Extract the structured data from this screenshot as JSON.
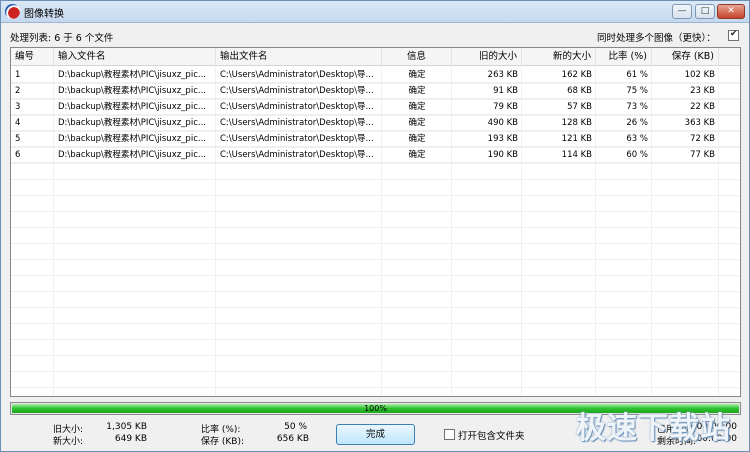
{
  "window": {
    "title": "图像转换",
    "buttons": {
      "minimize": "—",
      "maximize": "□",
      "close": "✕"
    }
  },
  "top": {
    "processing": "处理列表: 6 于 6 个文件",
    "multi_label": "同时处理多个图像（更快）：",
    "multi_checked": true
  },
  "table": {
    "columns": [
      "编号",
      "输入文件名",
      "输出文件名",
      "信息",
      "旧的大小",
      "新的大小",
      "比率 (%)",
      "保存 (KB)"
    ],
    "rows": [
      [
        "1",
        "D:\\backup\\教程素材\\PIC\\jisuxz_pic...",
        "C:\\Users\\Administrator\\Desktop\\导...",
        "确定",
        "263 KB",
        "162 KB",
        "61 %",
        "102 KB"
      ],
      [
        "2",
        "D:\\backup\\教程素材\\PIC\\jisuxz_pic...",
        "C:\\Users\\Administrator\\Desktop\\导...",
        "确定",
        "91 KB",
        "68 KB",
        "75 %",
        "23 KB"
      ],
      [
        "3",
        "D:\\backup\\教程素材\\PIC\\jisuxz_pic...",
        "C:\\Users\\Administrator\\Desktop\\导...",
        "确定",
        "79 KB",
        "57 KB",
        "73 %",
        "22 KB"
      ],
      [
        "4",
        "D:\\backup\\教程素材\\PIC\\jisuxz_pic...",
        "C:\\Users\\Administrator\\Desktop\\导...",
        "确定",
        "490 KB",
        "128 KB",
        "26 %",
        "363 KB"
      ],
      [
        "5",
        "D:\\backup\\教程素材\\PIC\\jisuxz_pic...",
        "C:\\Users\\Administrator\\Desktop\\导...",
        "确定",
        "193 KB",
        "121 KB",
        "63 %",
        "72 KB"
      ],
      [
        "6",
        "D:\\backup\\教程素材\\PIC\\jisuxz_pic...",
        "C:\\Users\\Administrator\\Desktop\\导...",
        "确定",
        "190 KB",
        "114 KB",
        "60 %",
        "77 KB"
      ]
    ]
  },
  "progress": {
    "value": 1.0,
    "label": "100%"
  },
  "stats": {
    "old_size_label": "旧大小:",
    "old_size": "1,305 KB",
    "new_size_label": "新大小:",
    "new_size": "649 KB",
    "ratio_label": "比率 (%):",
    "ratio": "50 %",
    "saved_label": "保存 (KB):",
    "saved": "656 KB",
    "used_time_label": "已用时间:",
    "used_time": "00:00:00",
    "remaining_label": "剩余时间:",
    "remaining": "00:00:00"
  },
  "done_button": "完成",
  "open_folder": {
    "label": "打开包含文件夹",
    "checked": false
  },
  "watermark": "极速下载站"
}
